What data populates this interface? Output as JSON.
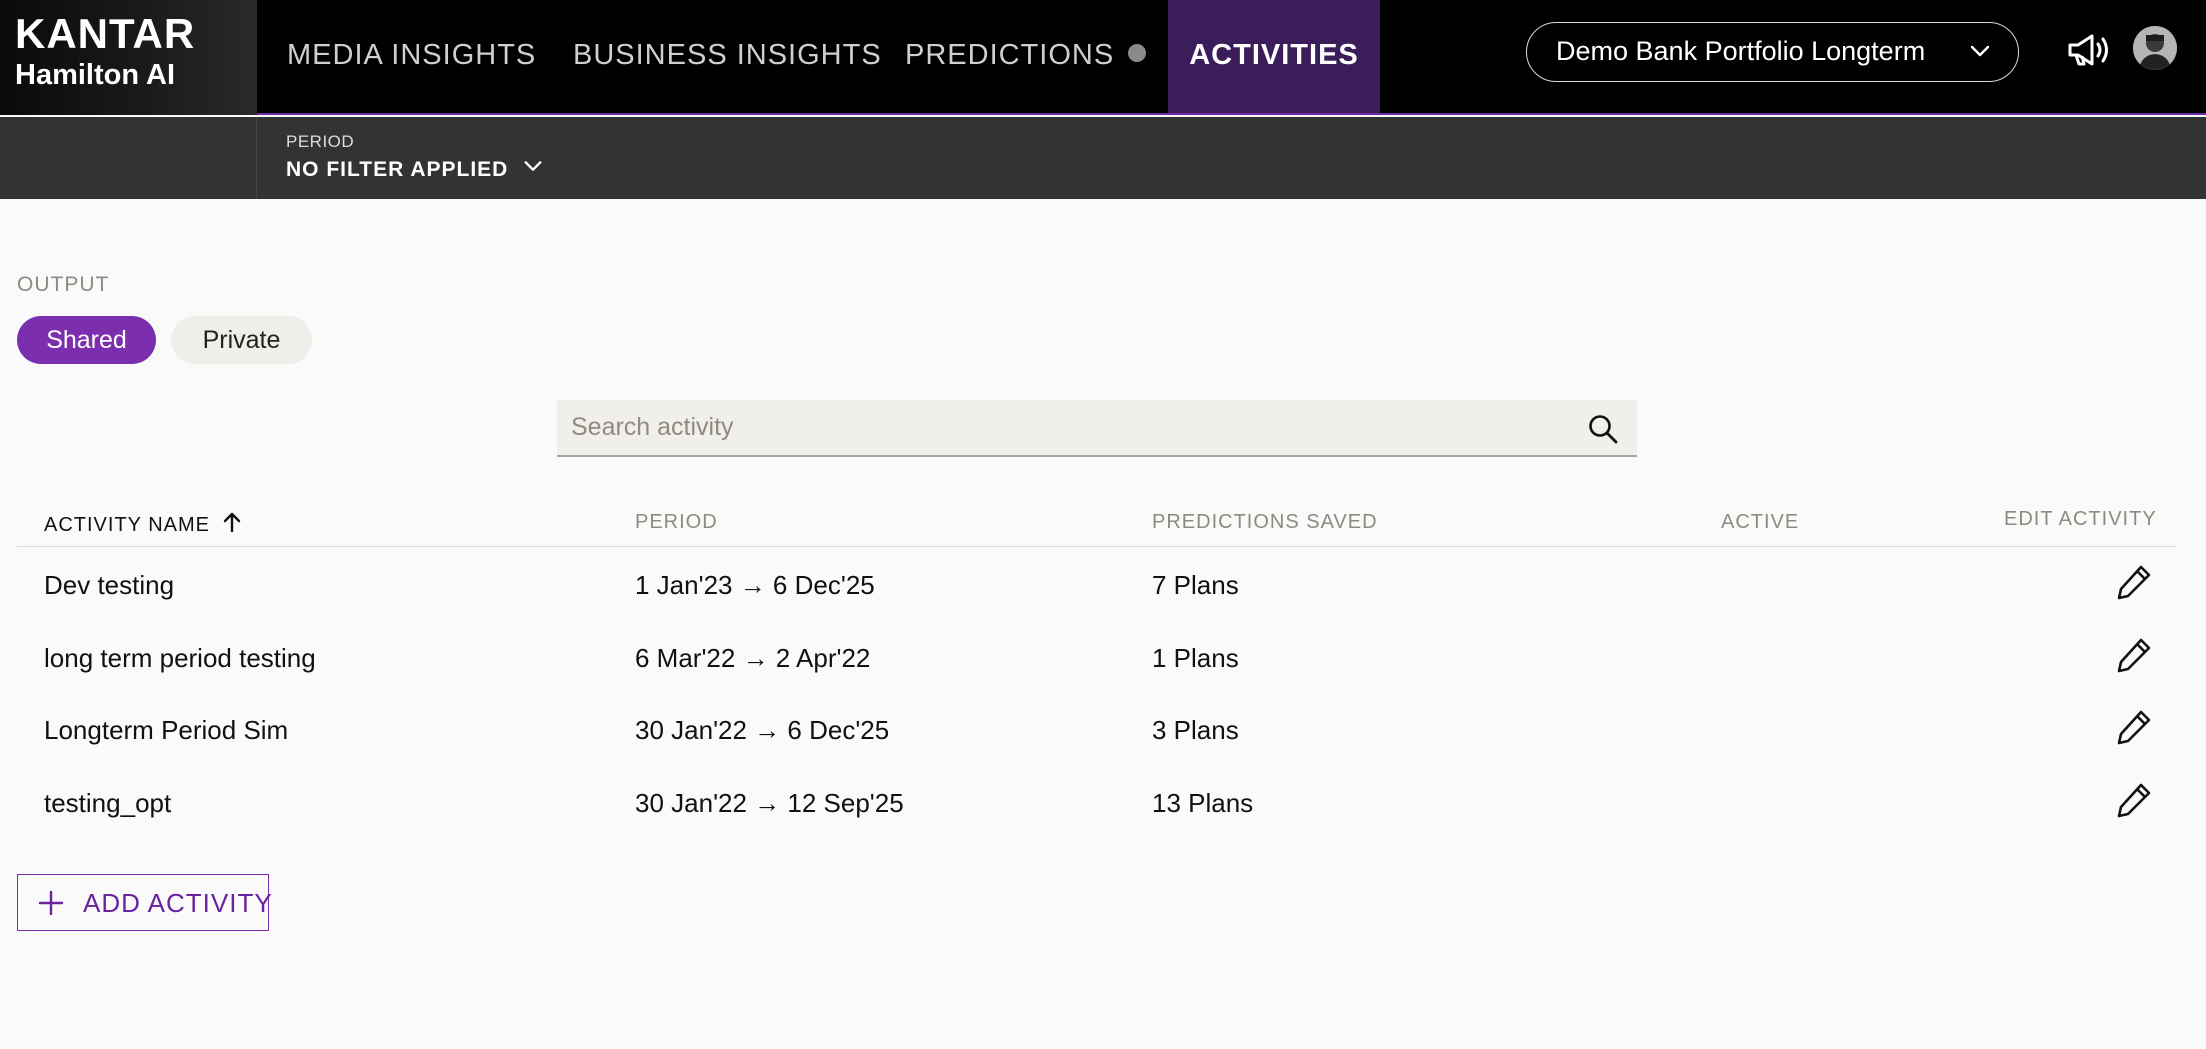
{
  "brand": {
    "line1": "KANTAR",
    "line2": "Hamilton AI"
  },
  "nav": {
    "items": [
      {
        "label": "MEDIA INSIGHTS"
      },
      {
        "label": "BUSINESS INSIGHTS"
      },
      {
        "label": "PREDICTIONS"
      },
      {
        "label": "ACTIVITIES",
        "active": true
      }
    ],
    "account": "Demo Bank Portfolio Longterm"
  },
  "filter": {
    "label": "PERIOD",
    "value": "NO FILTER APPLIED"
  },
  "output": {
    "label": "OUTPUT",
    "options": [
      "Shared",
      "Private"
    ],
    "selected": "Shared"
  },
  "search": {
    "placeholder": "Search activity",
    "value": ""
  },
  "table": {
    "columns": [
      "ACTIVITY NAME",
      "PERIOD",
      "PREDICTIONS SAVED",
      "ACTIVE",
      "EDIT ACTIVITY"
    ],
    "sort": {
      "column": "ACTIVITY NAME",
      "direction": "ascending"
    },
    "rows": [
      {
        "name": "Dev testing",
        "period": "1 Jan'23 → 6 Dec'25",
        "saved": "7 Plans"
      },
      {
        "name": "long term period testing",
        "period": "6 Mar'22 → 2 Apr'22",
        "saved": "1 Plans"
      },
      {
        "name": "Longterm Period Sim",
        "period": "30 Jan'22 → 6 Dec'25",
        "saved": "3 Plans"
      },
      {
        "name": "testing_opt",
        "period": "30 Jan'22 → 12 Sep'25",
        "saved": "13 Plans"
      }
    ]
  },
  "add_button": "ADD ACTIVITY",
  "colors": {
    "accent": "#7b2fae",
    "active_tab": "#3b1d5c",
    "topbar": "#000000",
    "filterbar": "#333333"
  },
  "icons": [
    "chevron-down-icon",
    "megaphone-icon",
    "avatar",
    "search-icon",
    "arrow-up-icon",
    "pencil-icon",
    "plus-icon"
  ]
}
